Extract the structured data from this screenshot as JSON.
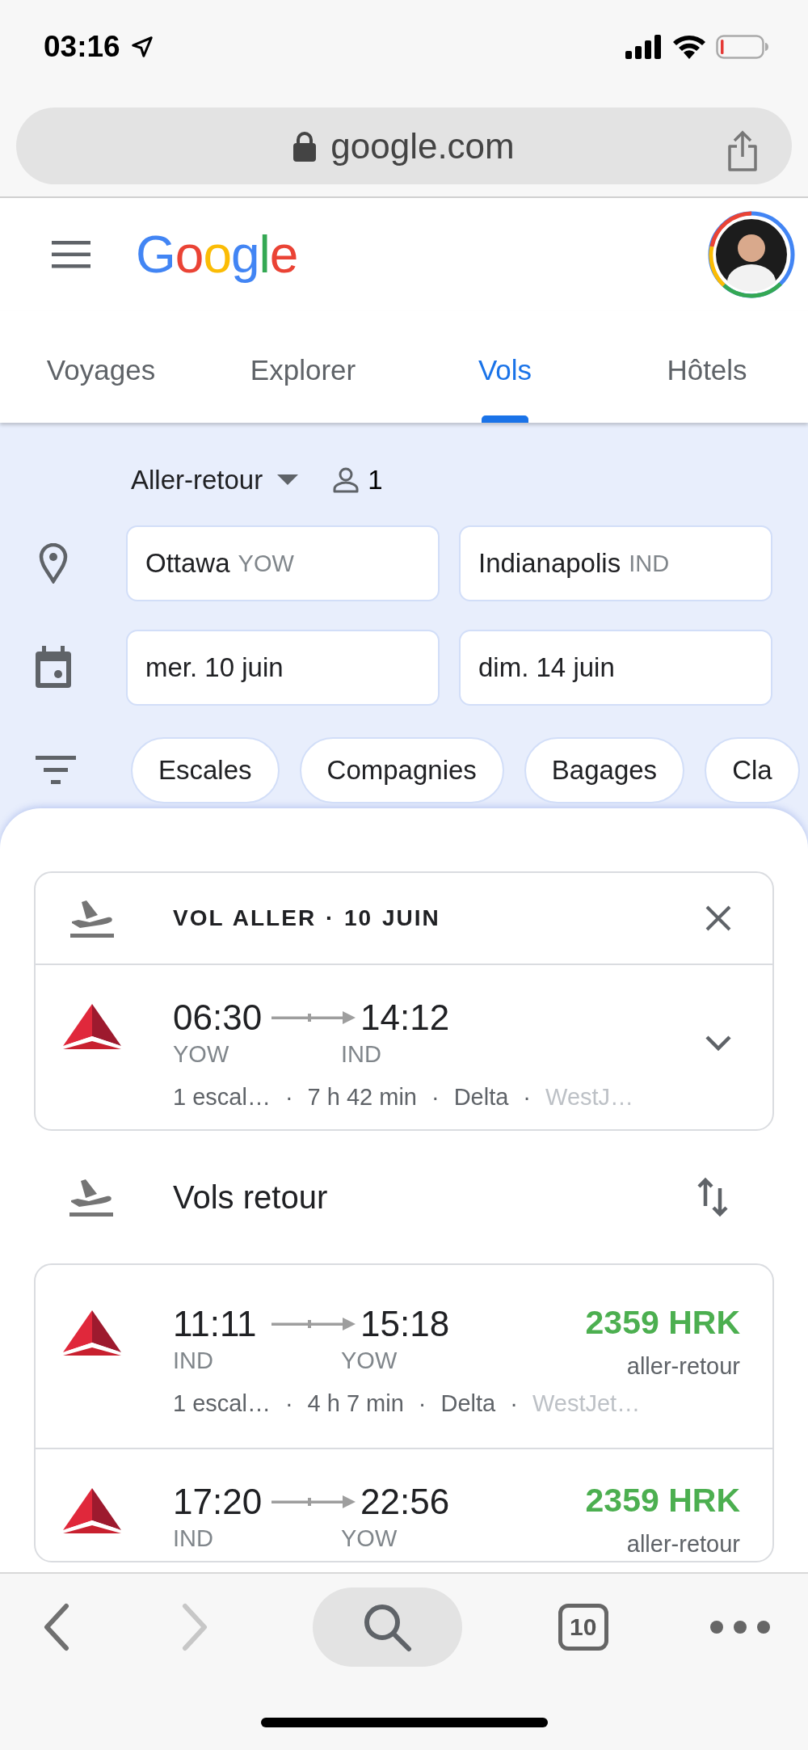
{
  "status_bar": {
    "time": "03:16"
  },
  "browser": {
    "url": "google.com"
  },
  "header": {
    "logo": "Google"
  },
  "tabs": [
    {
      "label": "Voyages",
      "selected": false
    },
    {
      "label": "Explorer",
      "selected": false
    },
    {
      "label": "Vols",
      "selected": true
    },
    {
      "label": "Hôtels",
      "selected": false
    }
  ],
  "search": {
    "trip_type": "Aller-retour",
    "passengers": "1",
    "origin": {
      "city": "Ottawa",
      "code": "YOW"
    },
    "destination": {
      "city": "Indianapolis",
      "code": "IND"
    },
    "departure_date": "mer. 10 juin",
    "return_date": "dim. 14 juin"
  },
  "filters": [
    "Escales",
    "Compagnies",
    "Bagages",
    "Cla"
  ],
  "selected_flight": {
    "heading": "VOL ALLER · 10 JUIN",
    "departure_time": "06:30",
    "departure_airport": "YOW",
    "arrival_time": "14:12",
    "arrival_airport": "IND",
    "details": [
      "1 escal…",
      "7 h 42 min",
      "Delta",
      "WestJ…"
    ],
    "separator": "·"
  },
  "return_section": {
    "title": "Vols retour"
  },
  "return_flights": [
    {
      "departure_time": "11:11",
      "departure_airport": "IND",
      "arrival_time": "15:18",
      "arrival_airport": "YOW",
      "price": "2359 HRK",
      "price_note": "aller-retour",
      "details": [
        "1 escal…",
        "4 h 7 min",
        "Delta",
        "WestJet…"
      ],
      "separator": "·"
    },
    {
      "departure_time": "17:20",
      "departure_airport": "IND",
      "arrival_time": "22:56",
      "arrival_airport": "YOW",
      "price": "2359 HRK",
      "price_note": "aller-retour"
    }
  ],
  "toolbar": {
    "back": {
      "disabled": false
    },
    "forward": {
      "disabled": true
    },
    "tab_count": "10"
  }
}
